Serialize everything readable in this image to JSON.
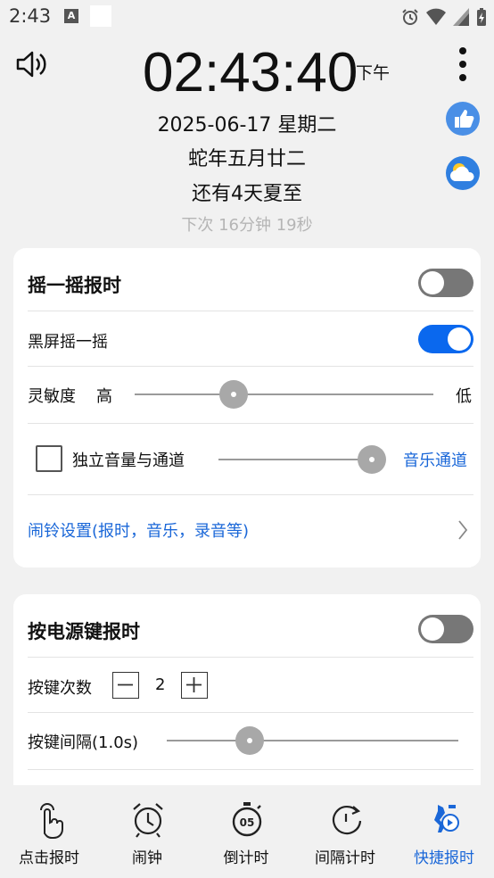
{
  "status_bar": {
    "time": "2:43",
    "a_icon": "A"
  },
  "header": {
    "clock": "02:43:40",
    "ampm": "下午",
    "date": "2025-06-17 星期二",
    "lunar": "蛇年五月廿二",
    "solar_term": "还有4天夏至",
    "next": "下次  16分钟 19秒"
  },
  "shake_card": {
    "title": "摇一摇报时",
    "title_toggle_on": false,
    "blackscreen_label": "黑屏摇一摇",
    "blackscreen_toggle_on": true,
    "sensitivity_label": "灵敏度",
    "sensitivity_high": "高",
    "sensitivity_low": "低",
    "independent_volume_label": "独立音量与通道",
    "independent_volume_checked": false,
    "music_channel_link": "音乐通道",
    "alarm_settings_link": "闹铃设置(报时，音乐，录音等)"
  },
  "power_card": {
    "title": "按电源键报时",
    "title_toggle_on": false,
    "press_count_label": "按键次数",
    "press_count_value": "2",
    "interval_label": "按键间隔(1.0s)"
  },
  "bottom_nav": [
    {
      "label": "点击报时",
      "icon": "tap-hand-icon"
    },
    {
      "label": "闹钟",
      "icon": "alarm-clock-icon"
    },
    {
      "label": "倒计时",
      "icon": "countdown-timer-icon"
    },
    {
      "label": "间隔计时",
      "icon": "interval-timer-icon"
    },
    {
      "label": "快捷报时",
      "icon": "quick-report-icon",
      "active": true
    }
  ],
  "colors": {
    "accent": "#1a67d8",
    "toggle_on": "#0a68ee",
    "toggle_off": "#777777"
  }
}
